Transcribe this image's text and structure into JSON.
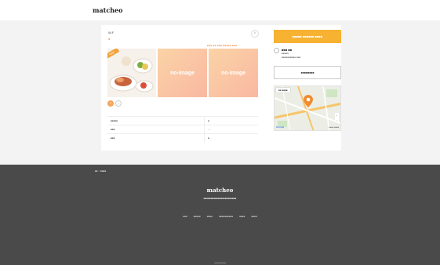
{
  "header": {
    "logo": "matcheo"
  },
  "post": {
    "title": "W.F",
    "subtitle": "●",
    "close_label": "×",
    "meta": "■■■ ■■ ■■■ ■■■■■ ■■■",
    "badge": "NEW",
    "no_image_label": "no-image",
    "arrow_prev": "‹",
    "arrow_next": "›",
    "specs": [
      {
        "label": "■■■■■",
        "value": "■"
      },
      {
        "label": "■■■",
        "value": "—"
      },
      {
        "label": "■■■",
        "value": "■"
      }
    ]
  },
  "side": {
    "cta_label": "■■■■■ ■■■■■■ ■■■■",
    "owner_name": "■■■ ■■",
    "owner_line1": "■■■■■",
    "owner_line2": "■■■■■■■■■■ ■■■",
    "inquiry_label": "■■■■■■■■",
    "map": {
      "tab_label": "■■ ■■■■",
      "brand": "Google",
      "credit": "■■■■ ■■■■",
      "zoom_in": "+",
      "zoom_out": "−"
    }
  },
  "breadcrumb": "■■ > ■■■■",
  "footer": {
    "logo": "matcheo",
    "tagline": "■■■■■■■■■■■■■■■■■■■■■■■",
    "links": [
      "■■■",
      "■■■■■",
      "■■■■",
      "■■■■■■■■■■",
      "■■■■",
      "■■■■"
    ],
    "copyright": "■■■■■■■■■■"
  },
  "colors": {
    "accent": "#f7b232",
    "noimage_from": "#fbd3a6",
    "noimage_to": "#f9b8a2",
    "footer": "#4a4a4a",
    "pin": "#f08b30"
  }
}
